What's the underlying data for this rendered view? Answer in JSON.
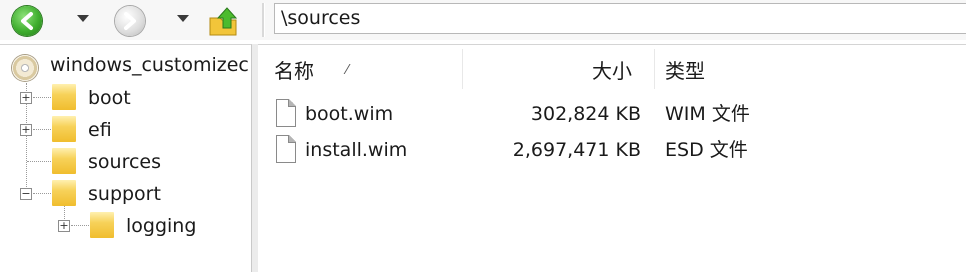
{
  "toolbar": {
    "back_icon": "back-arrow-icon",
    "forward_icon": "forward-arrow-icon",
    "up_icon": "up-folder-icon",
    "address": "\\sources"
  },
  "tree": {
    "root": {
      "label": "windows_customizec",
      "icon": "cd-drive-icon"
    },
    "items": [
      {
        "label": "boot",
        "expander": "+"
      },
      {
        "label": "efi",
        "expander": "+"
      },
      {
        "label": "sources",
        "expander": ""
      },
      {
        "label": "support",
        "expander": "−"
      },
      {
        "label": "logging",
        "expander": "+"
      }
    ]
  },
  "list": {
    "columns": {
      "name": "名称",
      "size": "大小",
      "type": "类型"
    },
    "files": [
      {
        "name": "boot.wim",
        "size": "302,824 KB",
        "type": "WIM 文件"
      },
      {
        "name": "install.wim",
        "size": "2,697,471 KB",
        "type": "ESD 文件"
      }
    ]
  },
  "colors": {
    "folder": "#f0bd2e",
    "back_button": "#3fae2e",
    "divider": "#c9c9c9"
  }
}
